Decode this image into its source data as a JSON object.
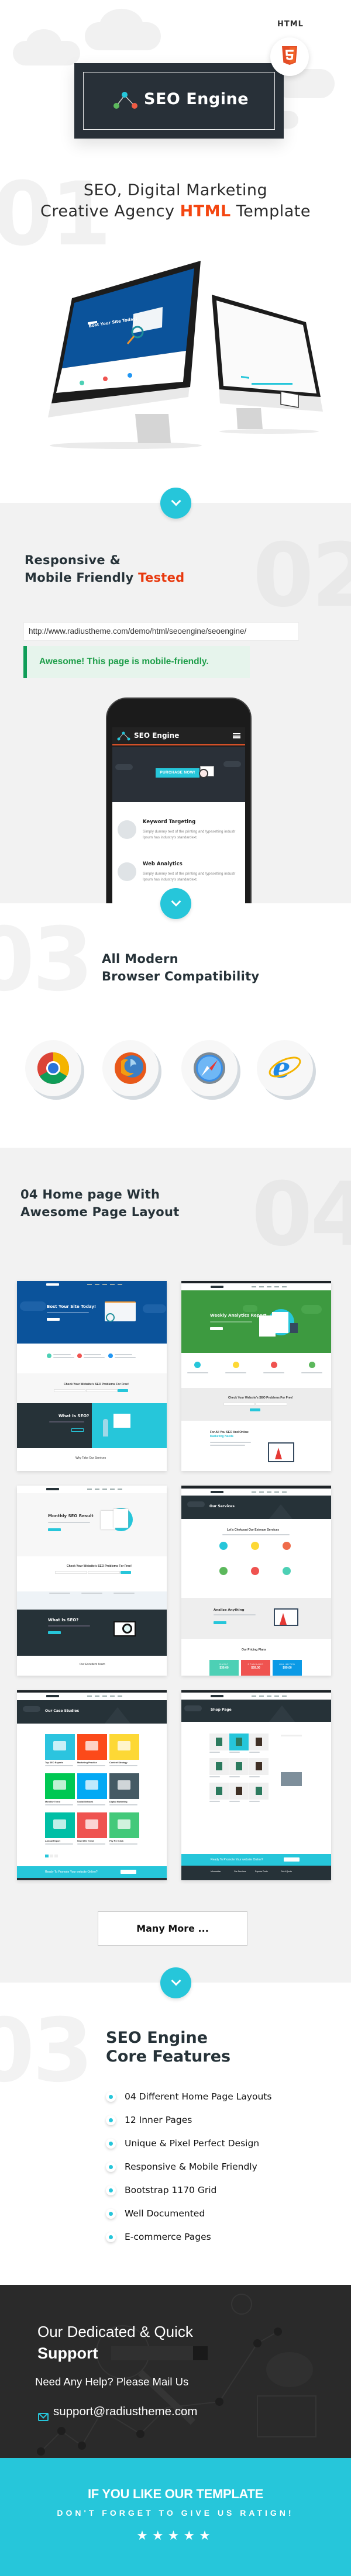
{
  "colors": {
    "accent": "#26c6da",
    "highlight": "#f44611",
    "dark": "#283038",
    "success": "#0f9d58",
    "gray_bg": "#f2f2f2"
  },
  "header": {
    "logo_text": "SEO Engine",
    "html_label": "HTML",
    "badge_icon": "html5-icon"
  },
  "hero": {
    "number": "01",
    "line1": "SEO, Digital Marketing",
    "line2_pre": "Creative Agency",
    "line2_highlight": "HTML",
    "line2_post": "Template",
    "monitor_headline": "Bost Your Site Today!"
  },
  "responsive": {
    "number": "02",
    "line1": "Responsive &",
    "line2_pre": "Mobile Friendly",
    "line2_highlight": "Tested",
    "url": "http://www.radiustheme.com/demo/html/seoengine/seoengine/",
    "alert": "Awesome! This page is mobile-friendly.",
    "phone": {
      "logo": "SEO Engine",
      "button": "PURCHASE NOW!",
      "features": [
        {
          "title": "Keyword Targeting",
          "text": "Simply dummy text of the printing and typesetting industr Ipsum has industry's standardext."
        },
        {
          "title": "Web Analytics",
          "text": "Simply dummy text of the printing and typesetting industr Ipsum has industry's standardext."
        }
      ]
    }
  },
  "browsers": {
    "number": "03",
    "line1": "All Modern",
    "line2": "Browser Compatibility",
    "items": [
      "chrome-icon",
      "firefox-icon",
      "safari-icon",
      "internet-explorer-icon"
    ]
  },
  "layouts": {
    "number": "04",
    "line1": "04 Home page With",
    "line2": "Awesome Page Layout",
    "more_button": "Many More ...",
    "cards": [
      {
        "headline": "Bost Your Site Today!",
        "check": "Check Your Website's SEO Problems For Free!",
        "split": "What Is SEO?",
        "bottom": "Why Take Our Services"
      },
      {
        "headline": "Weekly Analytics Report",
        "check": "Check Your Website's SEO Problems For Free!",
        "bottom1": "For All You SEO And Online",
        "bottom2": "Marketing Needs"
      },
      {
        "headline": "Monthly SEO Result",
        "check": "Check Your Website's SEO Problems For Free!",
        "dark": "What Is SEO?",
        "bottom": "Our Excellent Team"
      },
      {
        "banner": "Our Services",
        "title": "Let's Chekcout Our Extream Services",
        "analize": "Analize Anything",
        "pricing": "Our Pricing Plans",
        "plans": [
          {
            "name": "BASIC",
            "price": "$39.00"
          },
          {
            "name": "STANDARD",
            "price": "$59.00"
          },
          {
            "name": "UNLIMITED",
            "price": "$99.00"
          }
        ]
      },
      {
        "banner": "Our Case Studies",
        "tiles": [
          "Top SEO Experts",
          "Marketing Practice",
          "Content Strategy",
          "Monthly Trend",
          "Social Network",
          "Digital Marketing",
          "Annual Report",
          "New SEO Trend",
          "Pay Per Click"
        ],
        "cta": "Ready To Promote Your website Online?"
      },
      {
        "banner": "Shop Page",
        "cta": "Ready To Promote Your website Online?",
        "footer": [
          "Information",
          "Our Services",
          "Popular Posts",
          "Get A Quote"
        ]
      }
    ]
  },
  "features": {
    "number": "03",
    "line1": "SEO Engine",
    "line2": "Core Features",
    "items": [
      "04 Different Home Page Layouts",
      "12 Inner Pages",
      "Unique & Pixel Perfect Design",
      "Responsive & Mobile Friendly",
      "Bootstrap 1170 Grid",
      "Well Documented",
      "E-commerce Pages"
    ]
  },
  "support": {
    "line1": "Our Dedicated & Quick",
    "line2": "Support",
    "help": "Need Any Help? Please Mail Us",
    "email": "support@radiustheme.com"
  },
  "rating": {
    "line1": "IF YOU LIKE OUR TEMPLATE",
    "line2": "DON'T FORGET TO GIVE US RATIGN!",
    "stars": 5
  }
}
